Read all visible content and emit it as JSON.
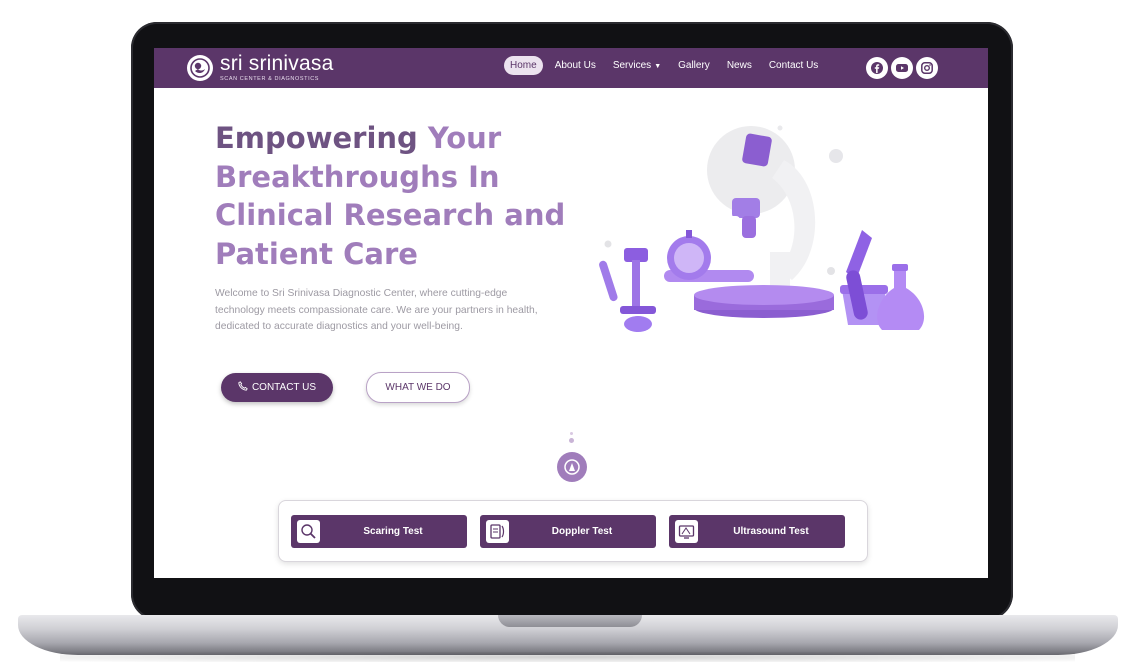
{
  "brand": {
    "name": "sri srinivasa",
    "tagline": "SCAN CENTER & DIAGNOSTICS",
    "logo_icon": "baby-scan-logo-icon"
  },
  "nav": {
    "items": [
      {
        "label": "Home",
        "active": true
      },
      {
        "label": "About Us"
      },
      {
        "label": "Services",
        "has_dropdown": true
      },
      {
        "label": "Gallery"
      },
      {
        "label": "News"
      },
      {
        "label": "Contact Us"
      }
    ],
    "social_icons": [
      "facebook-icon",
      "youtube-icon",
      "instagram-icon"
    ]
  },
  "hero": {
    "title_dark": "Empowering",
    "title_light": " Your Breakthroughs In Clinical Research and Patient Care",
    "description": "Welcome to Sri Srinivasa Diagnostic Center, where cutting-edge technology meets compassionate care. We are your partners in health, dedicated to accurate diagnostics and your well-being.",
    "contact_button": "CONTACT US",
    "contact_icon": "phone-icon",
    "what_button": "WHAT WE DO",
    "illustration": "lab-equipment-illustration"
  },
  "tests": [
    {
      "label": "Scaring Test",
      "icon": "scan-magnifier-icon"
    },
    {
      "label": "Doppler Test",
      "icon": "doppler-device-icon"
    },
    {
      "label": "Ultrasound Test",
      "icon": "ultrasound-monitor-icon"
    }
  ],
  "colors": {
    "primary": "#5b3669",
    "accent": "#a07dbb",
    "title_dark": "#6e5382",
    "body_text": "#9d9aa3"
  }
}
